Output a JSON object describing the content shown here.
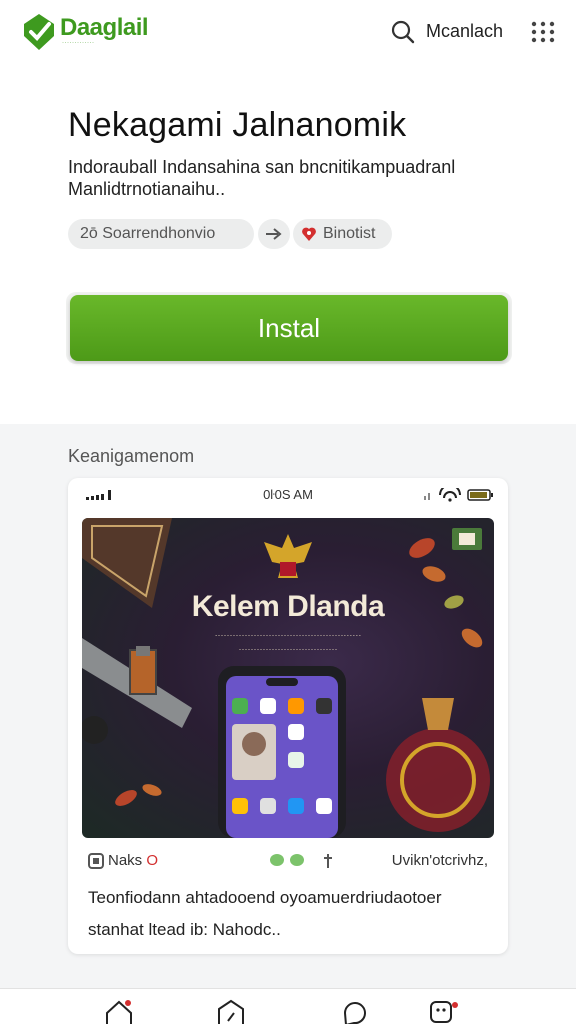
{
  "header": {
    "brand_name": "Daaglail",
    "brand_tagline": "·············",
    "search_label": "Mcanlach",
    "icons": [
      "logo-icon",
      "search-icon",
      "grid-menu-icon"
    ]
  },
  "app": {
    "title": "Nekagami Jalnanomik",
    "description": "Indorauball Indansahina san bncnitikampuadranl Manlidtrnotianaihu..",
    "chips": [
      {
        "label": "2ō  Soarrendhonvio"
      },
      {
        "label": ""
      },
      {
        "label": "Binotist"
      }
    ],
    "install_label": "Instal"
  },
  "screenshots": {
    "section_title": "Keanigamenom",
    "status_time": "0ŀ0S AM",
    "banner_title": "Kelem Dlanda",
    "banner_sub_1": "·················································",
    "banner_sub_2": "·································"
  },
  "card": {
    "meta_left": "Naks",
    "meta_left_suffix": "O",
    "meta_right": "Uvikn'otcrivhz,",
    "text": "Teonfiodann ahtadooend oyoamuerdriudaotoer stanhat ltead ib: Nahodc.."
  },
  "colors": {
    "accent": "#4d9a18",
    "brand": "#3e9a1f",
    "banner_bg": "#2a1e33"
  }
}
